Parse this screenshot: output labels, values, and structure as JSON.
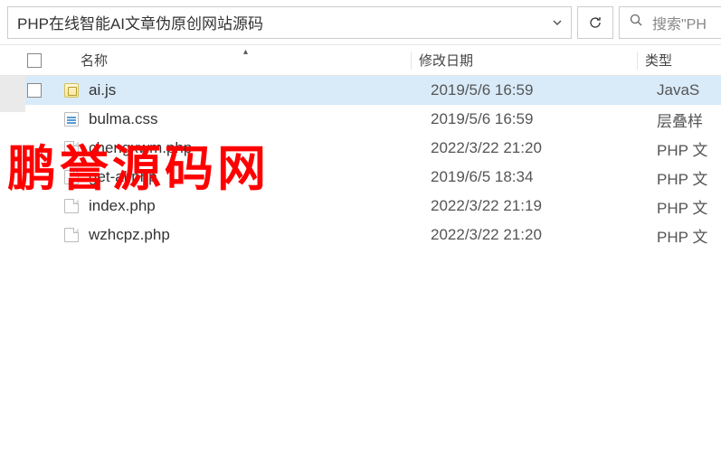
{
  "toolbar": {
    "path": "PHP在线智能AI文章伪原创网站源码",
    "search_placeholder": "搜索\"PH"
  },
  "columns": {
    "name": "名称",
    "date": "修改日期",
    "type": "类型"
  },
  "files": [
    {
      "name": "ai.js",
      "date": "2019/5/6 16:59",
      "type": "JavaS",
      "icon": "js",
      "selected": true
    },
    {
      "name": "bulma.css",
      "date": "2019/5/6 16:59",
      "type": "层叠样",
      "icon": "css",
      "selected": false
    },
    {
      "name": "chengxwm.php",
      "date": "2022/3/22 21:20",
      "type": "PHP 文",
      "icon": "generic",
      "selected": false
    },
    {
      "name": "get-ai.php",
      "date": "2019/6/5 18:34",
      "type": "PHP 文",
      "icon": "generic",
      "selected": false
    },
    {
      "name": "index.php",
      "date": "2022/3/22 21:19",
      "type": "PHP 文",
      "icon": "generic",
      "selected": false
    },
    {
      "name": "wzhcpz.php",
      "date": "2022/3/22 21:20",
      "type": "PHP 文",
      "icon": "generic",
      "selected": false
    }
  ],
  "watermark": "鹏誉源码网"
}
